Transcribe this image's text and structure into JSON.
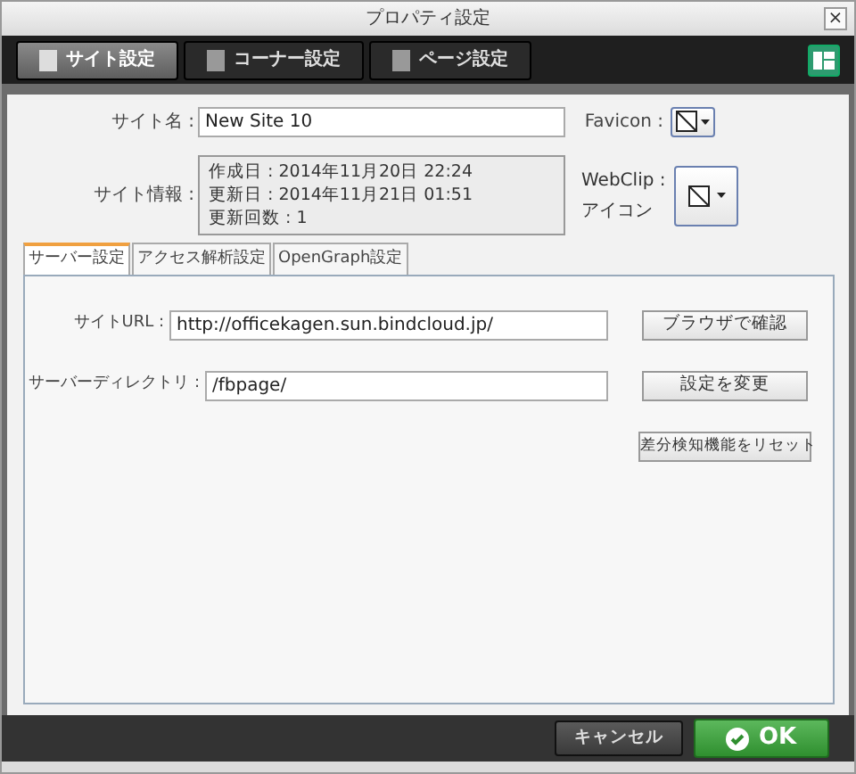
{
  "window": {
    "title": "プロパティ設定",
    "close": "×"
  },
  "tabs": [
    {
      "label": "サイト設定",
      "selected": true
    },
    {
      "label": "コーナー設定",
      "selected": false
    },
    {
      "label": "ページ設定",
      "selected": false
    }
  ],
  "site_name": {
    "label": "サイト名 :",
    "value": "New Site 10"
  },
  "favicon": {
    "label": "Favicon :"
  },
  "site_info": {
    "label": "サイト情報 :",
    "lines": [
      "作成日 : 2014年11月20日 22:24",
      "更新日 : 2014年11月21日 01:51",
      "更新回数 : 1"
    ]
  },
  "webclip": {
    "label_lines": [
      "WebClip :",
      "アイコン"
    ]
  },
  "sub_tabs": [
    {
      "label": "サーバー設定",
      "selected": true
    },
    {
      "label": "アクセス解析設定",
      "selected": false
    },
    {
      "label": "OpenGraph設定",
      "selected": false
    }
  ],
  "site_url": {
    "label": "サイトURL :",
    "value": "http://officekagen.sun.bindcloud.jp/",
    "button": "ブラウザで確認"
  },
  "server_dir": {
    "label": "サーバーディレクトリ :",
    "value": "/fbpage/",
    "button": "設定を変更"
  },
  "reset_button": "差分検知機能をリセット",
  "footer": {
    "cancel": "キャンセル",
    "ok": "OK"
  }
}
